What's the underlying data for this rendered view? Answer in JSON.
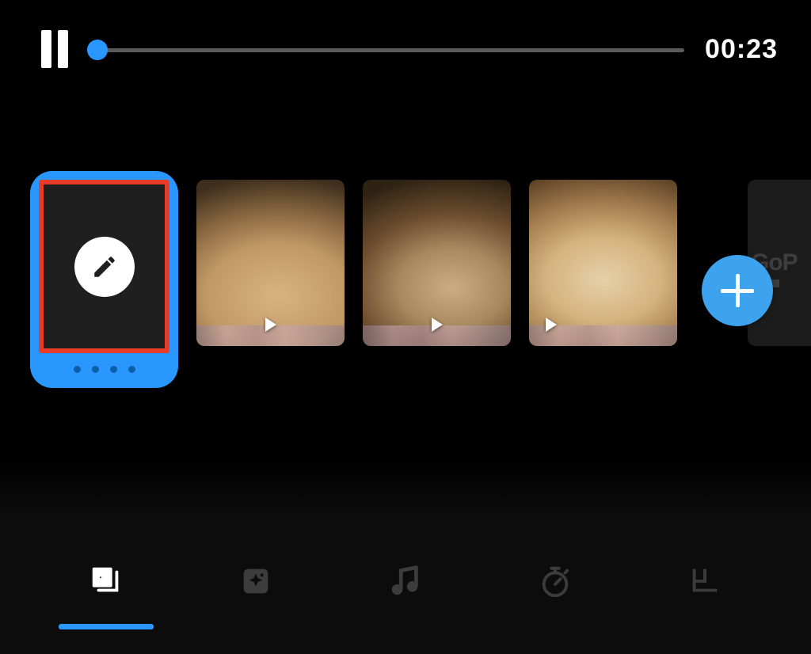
{
  "player": {
    "state": "playing",
    "time_label": "00:23",
    "progress_percent": 1.5
  },
  "colors": {
    "accent": "#2997ff",
    "highlight": "#e63c29",
    "add_button": "#3ea3ef"
  },
  "timeline": {
    "title_card": {
      "icon": "pencil-icon",
      "highlighted": true,
      "page_dots": 4
    },
    "clips": [
      {
        "id": "clip-1",
        "subject": "pomeranian-close-up",
        "has_play": true
      },
      {
        "id": "clip-2",
        "subject": "papillon-dog",
        "has_play": true
      },
      {
        "id": "clip-3",
        "subject": "pomeranian-side",
        "has_play": true
      }
    ],
    "add_button_icon": "plus-icon",
    "brand_tile_text": "GoP"
  },
  "bottom_nav": {
    "active_index": 0,
    "items": [
      {
        "name": "clips-tab",
        "icon": "clips-icon"
      },
      {
        "name": "effects-tab",
        "icon": "sparkle-icon"
      },
      {
        "name": "music-tab",
        "icon": "music-icon"
      },
      {
        "name": "speed-tab",
        "icon": "stopwatch-icon"
      },
      {
        "name": "layout-tab",
        "icon": "layout-icon"
      }
    ]
  }
}
